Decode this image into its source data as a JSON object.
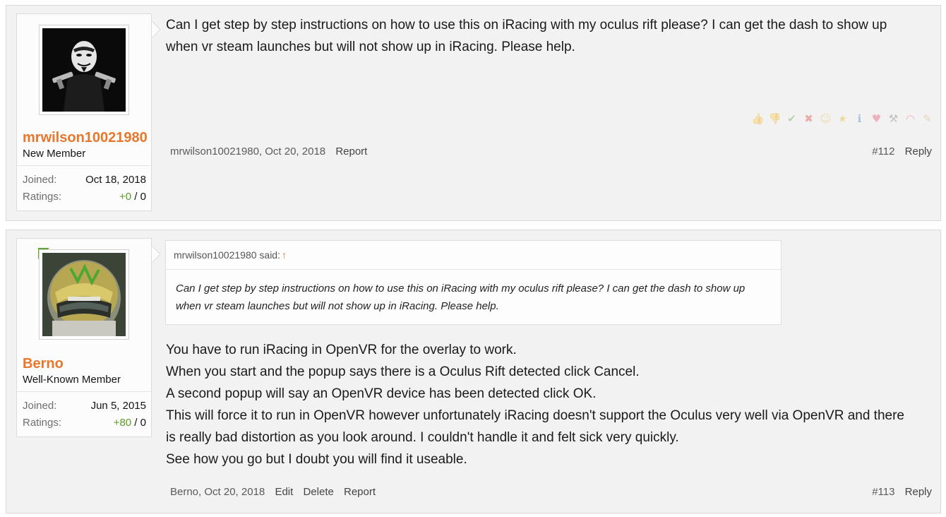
{
  "posts": [
    {
      "username": "mrwilson10021980",
      "user_title": "New Member",
      "joined_label": "Joined:",
      "joined_value": "Oct 18, 2018",
      "ratings_label": "Ratings:",
      "ratings_positive": "+0",
      "ratings_rest": " / 0",
      "avatar_icon": "masked-figure-avatar",
      "message_lines": [
        "Can I get step by step instructions on how to use this on iRacing with my oculus rift please? I can get the dash to show up",
        "when vr steam launches but will not show up in iRacing. Please help."
      ],
      "meta": "mrwilson10021980, Oct 20, 2018",
      "actions": [
        "Report"
      ],
      "post_number": "#112",
      "reply_label": "Reply"
    },
    {
      "username": "Berno",
      "user_title": "Well-Known Member",
      "joined_label": "Joined:",
      "joined_value": "Jun 5, 2015",
      "ratings_label": "Ratings:",
      "ratings_positive": "+80",
      "ratings_rest": " / 0",
      "avatar_icon": "racing-helmet-avatar",
      "quote": {
        "author": "mrwilson10021980 said:",
        "arrow": "↑",
        "lines": [
          "Can I get step by step instructions on how to use this on iRacing with my oculus rift please? I can get the dash to show up",
          "when vr steam launches but will not show up in iRacing. Please help."
        ]
      },
      "message_lines": [
        "You have to run iRacing in OpenVR for the overlay to work.",
        "When you start and the popup says there is a Oculus Rift detected click Cancel.",
        "A second popup will say an OpenVR device has been detected click OK.",
        "This will force it to run in OpenVR however unfortunately iRacing doesn't support the Oculus very well via OpenVR and there",
        "is really bad distortion as you look around. I couldn't handle it and felt sick very quickly.",
        "See how you go but I doubt you will find it useable."
      ],
      "meta": "Berno, Oct 20, 2018",
      "actions": [
        "Edit",
        "Delete",
        "Report"
      ],
      "post_number": "#113",
      "reply_label": "Reply"
    }
  ],
  "reaction_icons": [
    "thumbs-up-icon",
    "thumbs-down-icon",
    "check-icon",
    "x-icon",
    "smile-icon",
    "star-icon",
    "info-icon",
    "heart-icon",
    "wrench-icon",
    "rainbow-icon",
    "pencil-icon"
  ],
  "colors": {
    "accent": "#e8762b",
    "positive": "#5b9a29",
    "post_bg": "#f2f2f2"
  }
}
